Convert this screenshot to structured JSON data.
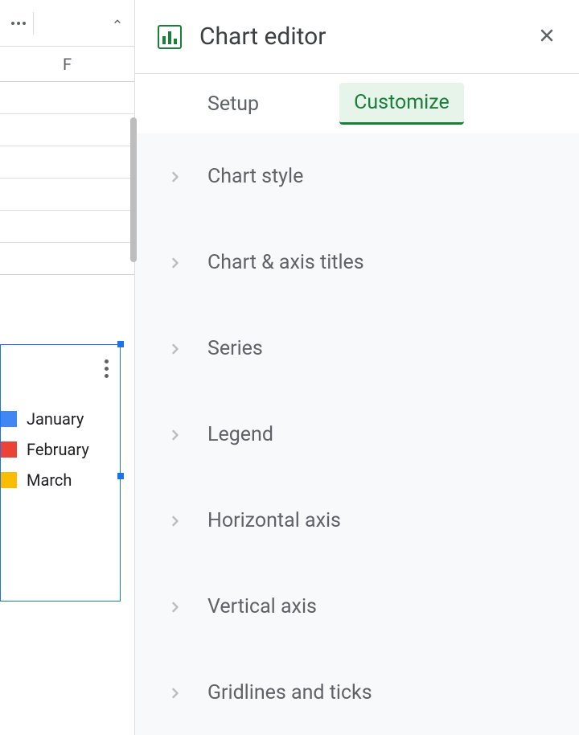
{
  "sheet": {
    "column_letter": "F",
    "legend_items": [
      {
        "label": "January",
        "color": "#4285f4"
      },
      {
        "label": "February",
        "color": "#ea4335"
      },
      {
        "label": "March",
        "color": "#fbbc04"
      }
    ]
  },
  "editor": {
    "title": "Chart editor",
    "tabs": {
      "setup": "Setup",
      "customize": "Customize",
      "active": "customize"
    },
    "sections": [
      "Chart style",
      "Chart & axis titles",
      "Series",
      "Legend",
      "Horizontal axis",
      "Vertical axis",
      "Gridlines and ticks"
    ]
  }
}
